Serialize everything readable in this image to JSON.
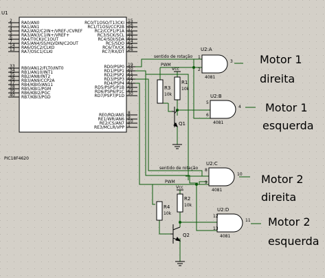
{
  "mcu": {
    "ref": "U1",
    "part": "PIC18F4620",
    "left_pins": [
      {
        "num": "2",
        "name": "RA0/AN0"
      },
      {
        "num": "3",
        "name": "RA1/AN1"
      },
      {
        "num": "4",
        "name": "RA2/AN2/C2IN+/VREF-/CVREF"
      },
      {
        "num": "5",
        "name": "RA3/AN3/C1IN+/VREF+"
      },
      {
        "num": "6",
        "name": "RA4/T0CKI/C1OUT"
      },
      {
        "num": "7",
        "name": "RA5/AN4/SS/HLVDIN/C2OUT"
      },
      {
        "num": "14",
        "name": "RA6/OSC2/CLKO"
      },
      {
        "num": "13",
        "name": "RA7/OSC1/CLKI"
      },
      {
        "num": "33",
        "name": "RB0/AN12/FLT0/INT0"
      },
      {
        "num": "34",
        "name": "RB1/AN10/INT1"
      },
      {
        "num": "35",
        "name": "RB2/AN8/INT2"
      },
      {
        "num": "36",
        "name": "RB3/AN9/CCP2A"
      },
      {
        "num": "37",
        "name": "RB4/KBI0/AN11"
      },
      {
        "num": "38",
        "name": "RB5/KBI1/PGM"
      },
      {
        "num": "39",
        "name": "RB6/KBI2/PGC"
      },
      {
        "num": "40",
        "name": "RB7/KBI3/PGD"
      }
    ],
    "right_pins": [
      {
        "num": "15",
        "name": "RC0/T1OSO/T13CKI"
      },
      {
        "num": "16",
        "name": "RC1/T1OSI/CCP2B"
      },
      {
        "num": "17",
        "name": "RC2/CCP1/P1A"
      },
      {
        "num": "18",
        "name": "RC3/SCK/SCL"
      },
      {
        "num": "23",
        "name": "RC4/SDI/SDA"
      },
      {
        "num": "24",
        "name": "RC5/SDO"
      },
      {
        "num": "25",
        "name": "RC6/TX/CK"
      },
      {
        "num": "26",
        "name": "RC7/RX/DT"
      },
      {
        "num": "19",
        "name": "RD0/PSP0"
      },
      {
        "num": "20",
        "name": "RD1/PSP1"
      },
      {
        "num": "21",
        "name": "RD2/PSP2"
      },
      {
        "num": "22",
        "name": "RD3/PSP3"
      },
      {
        "num": "27",
        "name": "RD4/PSP4"
      },
      {
        "num": "28",
        "name": "RD5/PSP5/P1B"
      },
      {
        "num": "29",
        "name": "RD6/PSP6/P1C"
      },
      {
        "num": "30",
        "name": "RD7/PSP7/P1D"
      },
      {
        "num": "8",
        "name": "RE0/RD/AN5"
      },
      {
        "num": "9",
        "name": "RE1/WR/AN6"
      },
      {
        "num": "10",
        "name": "RE2/CS/AN7"
      },
      {
        "num": "1",
        "name": "RE3/MCLR/VPP"
      }
    ]
  },
  "net_labels": {
    "dir1": "sentido de rotação",
    "pwm1": "PWM",
    "dir2": "sentido de rotação",
    "pwm2": "PWM"
  },
  "gates": [
    {
      "ref": "U2:A",
      "part": "4081",
      "in1": "1",
      "in2": "2",
      "out": "3"
    },
    {
      "ref": "U2:B",
      "part": "4081",
      "in1": "5",
      "in2": "6",
      "out": "4"
    },
    {
      "ref": "U2:C",
      "part": "4081",
      "in1": "8",
      "in2": "9",
      "out": "10"
    },
    {
      "ref": "U2:D",
      "part": "4081",
      "in1": "12",
      "in2": "13",
      "out": "11"
    }
  ],
  "passives": {
    "r1": {
      "ref": "R1",
      "value": "10k"
    },
    "r2": {
      "ref": "R2",
      "value": "10k"
    },
    "r3": {
      "ref": "R3",
      "value": "10k"
    },
    "r4": {
      "ref": "R4",
      "value": "10k"
    },
    "q1": "Q1",
    "q2": "Q2",
    "vcc1": "Vcc",
    "vcc2": "Vcc"
  },
  "motor_labels": {
    "m1r_a": "Motor 1",
    "m1r_b": "direita",
    "m1l_a": "Motor 1",
    "m1l_b": "esquerda",
    "m2r_a": "Motor 2",
    "m2r_b": "direita",
    "m2l_a": "Motor 2",
    "m2l_b": "esquerda"
  }
}
